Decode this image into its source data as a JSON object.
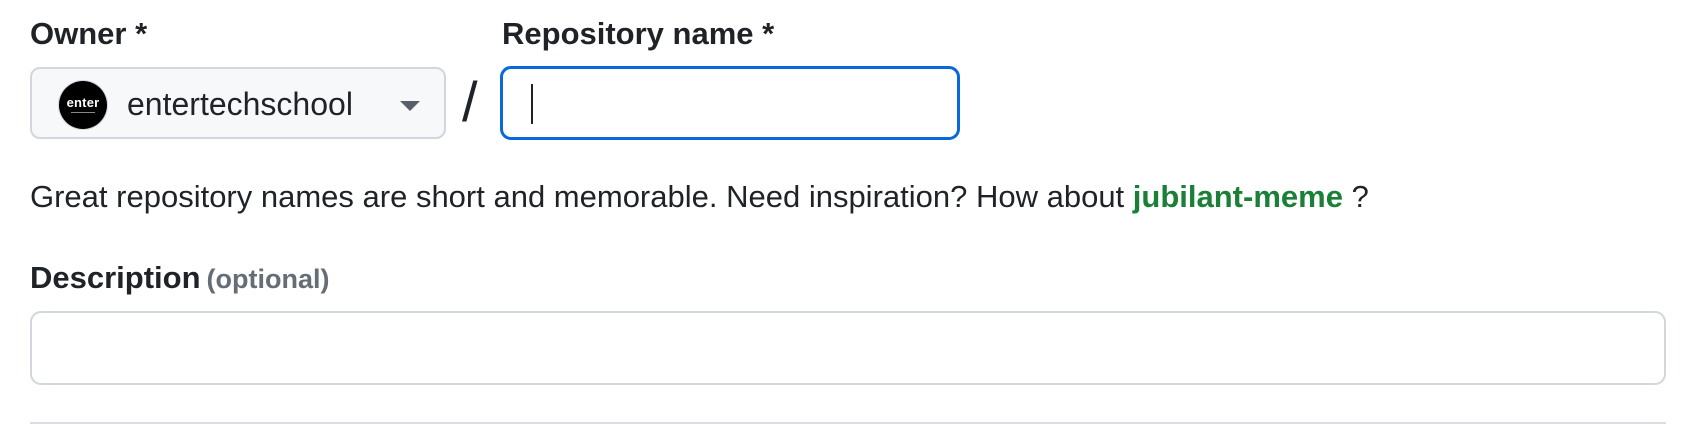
{
  "form": {
    "owner": {
      "label": "Owner *",
      "selected": "entertechschool",
      "avatar_text": "enter",
      "avatar_icon": "organization-avatar"
    },
    "separator": "/",
    "repository_name": {
      "label": "Repository name *",
      "value": "",
      "placeholder": ""
    },
    "hint": {
      "prefix": "Great repository names are short and memorable. Need inspiration? How about ",
      "suggestion": "jubilant-meme",
      "suffix": " ?"
    },
    "description": {
      "label": "Description",
      "optional_label": "(optional)",
      "value": "",
      "placeholder": ""
    }
  },
  "colors": {
    "focus_border": "#0969da",
    "suggestion_green": "#1a7f37",
    "muted_text": "#656d76",
    "border": "#d0d7de"
  }
}
